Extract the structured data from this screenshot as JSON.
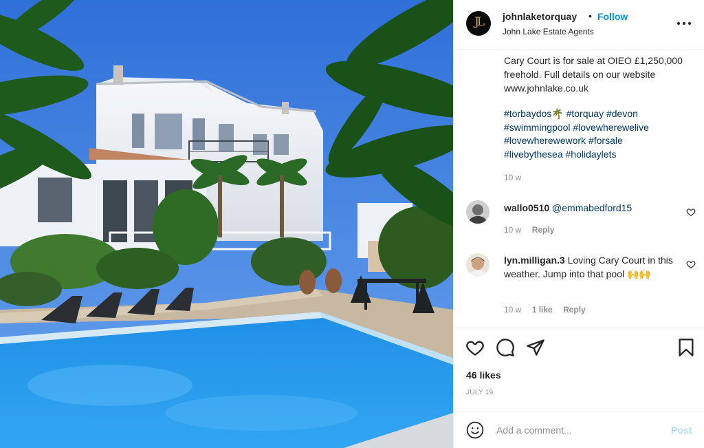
{
  "post": {
    "username": "johnlaketorquay",
    "separator": "•",
    "follow_label": "Follow",
    "subtitle": "John Lake Estate Agents",
    "logo_text": "JL",
    "more_icon": "ellipsis-icon",
    "caption": "Cary Court is for sale at OIEO £1,250,000 freehold. Full details on our website www.johnlake.co.uk",
    "hashtags": [
      "#torbaydos🌴",
      "#torquay",
      "#devon",
      "#swimmingpool",
      "#lovewherewelive",
      "#lovewherewework",
      "#forsale",
      "#livebythesea",
      "#holidaylets"
    ],
    "age": "10 w"
  },
  "comments": [
    {
      "user": "wallo0510",
      "text": "",
      "mention": "@emmabedford15",
      "age": "10 w",
      "likes": "",
      "reply_label": "Reply"
    },
    {
      "user": "lyn.milligan.3",
      "text": "Loving Cary Court in this weather. Jump into that pool 🙌🙌",
      "mention": "",
      "age": "10 w",
      "likes": "1 like",
      "reply_label": "Reply"
    }
  ],
  "actions": {
    "like_icon": "heart-icon",
    "comment_icon": "comment-icon",
    "share_icon": "share-icon",
    "save_icon": "bookmark-icon",
    "likes": "46 likes",
    "date": "JULY 19"
  },
  "add_comment": {
    "placeholder": "Add a comment...",
    "post_label": "Post",
    "emoji_icon": "smiley-icon"
  },
  "colors": {
    "accent": "#0095f6",
    "hashtag": "#00376b",
    "muted": "#8e8e8e",
    "post_disabled": "#b2dffc"
  }
}
